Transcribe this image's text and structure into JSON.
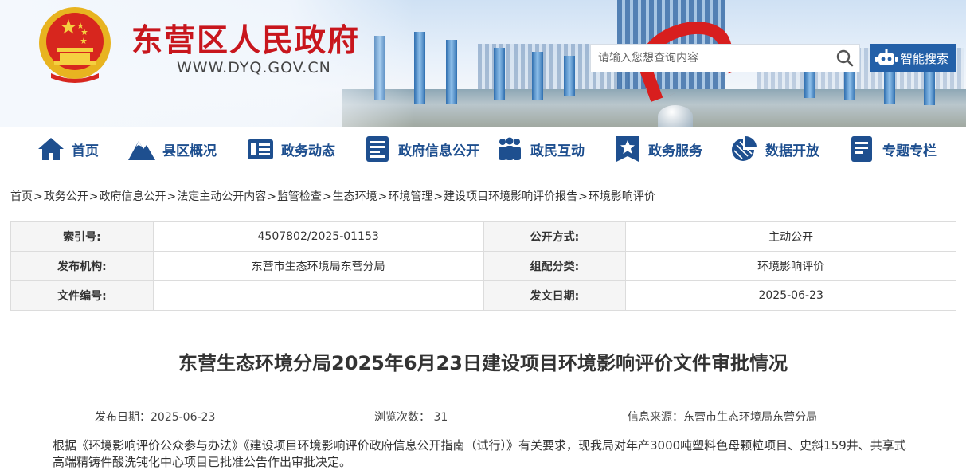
{
  "header": {
    "site_name": "东营区人民政府",
    "site_url": "WWW.DYQ.GOV.CN",
    "search_placeholder": "请输入您想查询内容",
    "smart_search_label": "智能搜索"
  },
  "nav": {
    "items": [
      {
        "label": "首页",
        "icon": "home-icon"
      },
      {
        "label": "县区概况",
        "icon": "mountain-icon"
      },
      {
        "label": "政务动态",
        "icon": "news-icon"
      },
      {
        "label": "政府信息公开",
        "icon": "id-card-icon"
      },
      {
        "label": "政民互动",
        "icon": "people-icon"
      },
      {
        "label": "政务服务",
        "icon": "star-bookmark-icon"
      },
      {
        "label": "数据开放",
        "icon": "pie-chart-icon"
      },
      {
        "label": "专题专栏",
        "icon": "document-icon"
      }
    ]
  },
  "breadcrumb": [
    "首页",
    "政务公开",
    "政府信息公开",
    "法定主动公开内容",
    "监管检查",
    "生态环境",
    "环境管理",
    "建设项目环境影响评价报告",
    "环境影响评价"
  ],
  "meta": {
    "index_label": "索引号:",
    "index_value": "4507802/2025-01153",
    "public_label": "公开方式:",
    "public_value": "主动公开",
    "org_label": "发布机构:",
    "org_value": "东营市生态环境局东营分局",
    "cat_label": "组配分类:",
    "cat_value": "环境影响评价",
    "docno_label": "文件编号:",
    "docno_value": "",
    "date_label": "发文日期:",
    "date_value": "2025-06-23"
  },
  "article": {
    "title": "东营生态环境分局2025年6月23日建设项目环境影响评价文件审批情况",
    "publish_date": "发布日期：2025-06-23",
    "views": "浏览次数：  31",
    "source": "信息来源：东营市生态环境局东营分局",
    "body": "根据《环境影响评价公众参与办法》《建设项目环境影响评价政府信息公开指南（试行）》有关要求，现我局对年产3000吨塑料色母颗粒项目、史斜159井、共享式高端精铸件酸洗钝化中心项目已批准公告作出审批决定。"
  },
  "colors": {
    "brand_red": "#c8161d",
    "nav_blue": "#1e4f8f",
    "button_blue": "#2360a8"
  }
}
